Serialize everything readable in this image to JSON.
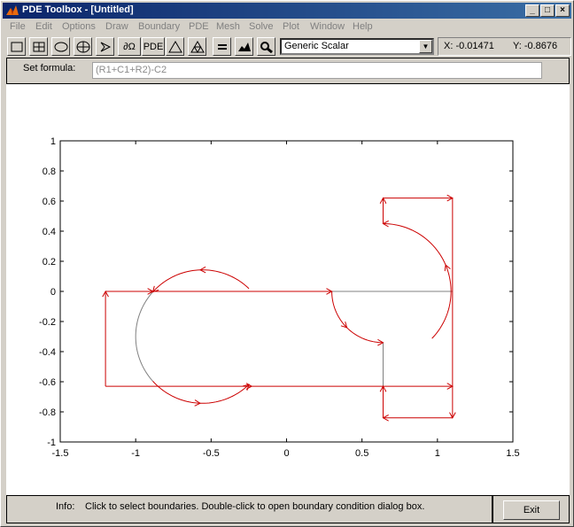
{
  "window": {
    "title": "PDE Toolbox - [Untitled]",
    "controls": [
      "_",
      "□",
      "×"
    ]
  },
  "menu": [
    "File",
    "Edit",
    "Options",
    "Draw",
    "Boundary",
    "PDE",
    "Mesh",
    "Solve",
    "Plot",
    "Window",
    "Help"
  ],
  "toolbar": {
    "pde_label": "PDE",
    "app_mode": "Generic Scalar",
    "x_coord": "X: -0.01471",
    "y_coord": "Y: -0.8676"
  },
  "formula": {
    "label": "Set formula:",
    "value": "(R1+C1+R2)-C2"
  },
  "chart_data": {
    "type": "line",
    "xlim": [
      -1.5,
      1.5
    ],
    "ylim": [
      -1,
      1
    ],
    "xticks": [
      "-1.5",
      "-1",
      "-0.5",
      "0",
      "0.5",
      "1",
      "1.5"
    ],
    "yticks": [
      "1",
      "0.8",
      "0.6",
      "0.4",
      "0.2",
      "0",
      "-0.2",
      "-0.4",
      "-0.6",
      "-0.8",
      "-1"
    ],
    "grid": false,
    "boundary_color": "#cc0000",
    "subdomain_color": "#808080",
    "boundaries": [
      {
        "kind": "segment",
        "from": [
          -1.2,
          0
        ],
        "to": [
          -0.885,
          0
        ]
      },
      {
        "kind": "segment",
        "from": [
          -0.885,
          0
        ],
        "to": [
          0.3,
          0
        ]
      },
      {
        "kind": "segment",
        "from": [
          -1.2,
          -0.63
        ],
        "to": [
          -1.2,
          0
        ]
      },
      {
        "kind": "segment",
        "from": [
          -1.2,
          -0.63
        ],
        "to": [
          -0.231,
          -0.63
        ]
      },
      {
        "kind": "segment",
        "from": [
          -0.231,
          -0.63
        ],
        "to": [
          1.1,
          -0.63
        ]
      },
      {
        "kind": "segment",
        "from": [
          0.64,
          0.62
        ],
        "to": [
          1.1,
          0.62
        ]
      },
      {
        "kind": "segment",
        "from": [
          1.1,
          0.62
        ],
        "to": [
          1.1,
          -0.84
        ]
      },
      {
        "kind": "segment",
        "from": [
          1.1,
          -0.84
        ],
        "to": [
          0.64,
          -0.84
        ]
      },
      {
        "kind": "segment",
        "from": [
          0.64,
          -0.84
        ],
        "to": [
          0.64,
          -0.63
        ]
      },
      {
        "kind": "segment",
        "from": [
          0.64,
          0.45
        ],
        "to": [
          0.64,
          0.62
        ]
      },
      {
        "kind": "arc",
        "center": [
          -0.557,
          -0.3
        ],
        "r": 0.443,
        "from_deg": 46,
        "to_deg": 138
      },
      {
        "kind": "arc",
        "center": [
          -0.557,
          -0.3
        ],
        "r": 0.443,
        "from_deg": 222,
        "to_deg": 314
      },
      {
        "kind": "arc",
        "center": [
          0.64,
          0
        ],
        "r": 0.34,
        "from_deg": 180,
        "to_deg": 270
      },
      {
        "kind": "arc",
        "center": [
          0.64,
          0
        ],
        "r": 0.45,
        "from_deg": -44,
        "to_deg": 90
      }
    ],
    "subdomain_edges": [
      {
        "kind": "arc",
        "center": [
          -0.557,
          -0.3
        ],
        "r": 0.443,
        "from_deg": 138,
        "to_deg": 222
      },
      {
        "kind": "segment",
        "from": [
          0.3,
          0
        ],
        "to": [
          1.1,
          0
        ]
      },
      {
        "kind": "segment",
        "from": [
          0.64,
          -0.34
        ],
        "to": [
          0.64,
          -0.63
        ]
      }
    ]
  },
  "status": {
    "label": "Info:",
    "text": "Click to select boundaries. Double-click to open boundary condition dialog box."
  },
  "exit": {
    "label": "Exit"
  }
}
